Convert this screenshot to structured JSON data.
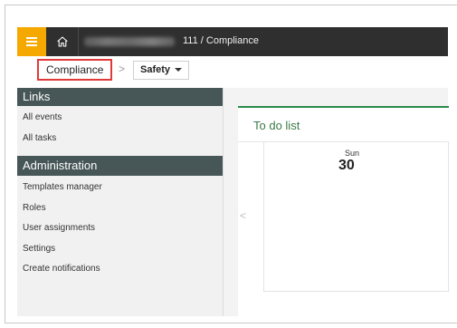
{
  "topbar": {
    "path_suffix": "111 / Compliance"
  },
  "breadcrumbs": {
    "compliance_label": "Compliance",
    "separator": ">",
    "safety_label": "Safety"
  },
  "sidebar": {
    "links_header": "Links",
    "links": [
      "All events",
      "All tasks"
    ],
    "admin_header": "Administration",
    "admin_items": [
      "Templates manager",
      "Roles",
      "User assignments",
      "Settings",
      "Create notifications"
    ]
  },
  "main": {
    "panel_title": "To do list",
    "day_name": "Sun",
    "day_number": "30",
    "prev_glyph": "<"
  },
  "colors": {
    "accent": "#f5a800",
    "topbar": "#2f2f2f",
    "sidebar_header": "#475657",
    "panel_border": "#2b8a4a",
    "highlight": "#e03a3a"
  }
}
